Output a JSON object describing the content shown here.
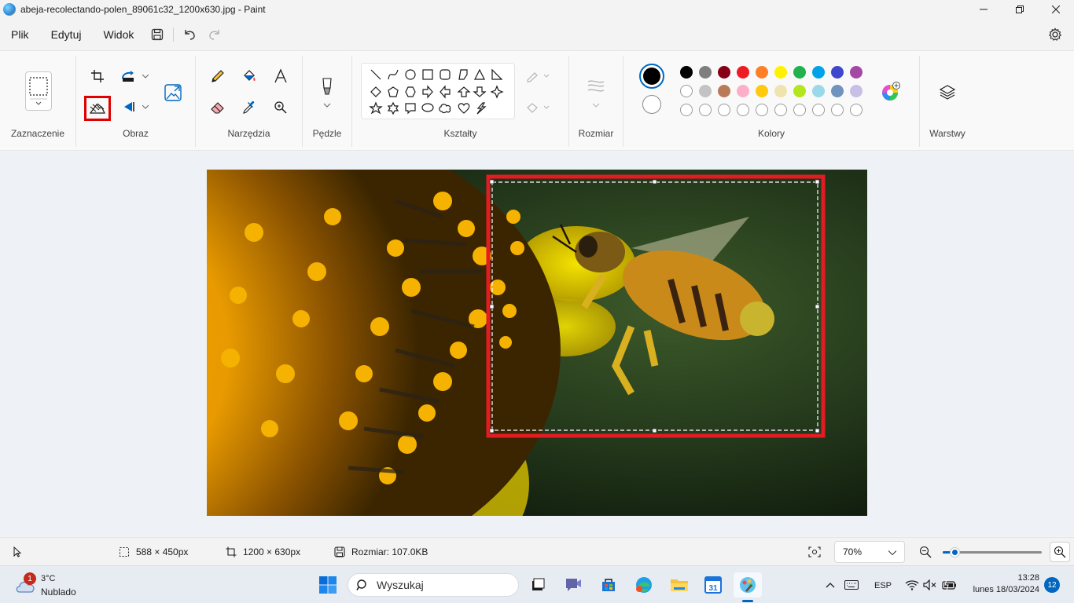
{
  "window": {
    "title": "abeja-recolectando-polen_89061c32_1200x630.jpg - Paint"
  },
  "menu": {
    "items": [
      "Plik",
      "Edytuj",
      "Widok"
    ]
  },
  "ribbon": {
    "groups": {
      "selection": "Zaznaczenie",
      "image": "Obraz",
      "tools": "Narzędzia",
      "brushes": "Pędzle",
      "shapes": "Kształty",
      "size": "Rozmiar",
      "colors": "Kolory",
      "layers": "Warstwy"
    },
    "colors": {
      "primary": "#000000",
      "secondary": "#ffffff",
      "palette_row1": [
        "#000000",
        "#7f7f7f",
        "#880015",
        "#ed1c24",
        "#ff7f27",
        "#fff200",
        "#22b14c",
        "#00a2e8",
        "#3f48cc",
        "#a349a4"
      ],
      "palette_row2": [
        "#ffffff",
        "#c3c3c3",
        "#b97a57",
        "#ffaec9",
        "#ffc90e",
        "#efe4b0",
        "#b5e61d",
        "#99d9ea",
        "#7092be",
        "#c8bfe7"
      ]
    }
  },
  "status": {
    "selection_size": "588 × 450px",
    "image_size": "1200 × 630px",
    "file_size": "Rozmiar: 107.0KB",
    "zoom": "70%",
    "zoom_level": 0.12
  },
  "taskbar": {
    "weather_temp": "3°C",
    "weather_desc": "Nublado",
    "weather_badge": "1",
    "search_placeholder": "Wyszukaj",
    "language": "ESP",
    "time": "13:28",
    "date": "lunes 18/03/2024",
    "notifications": "12"
  }
}
